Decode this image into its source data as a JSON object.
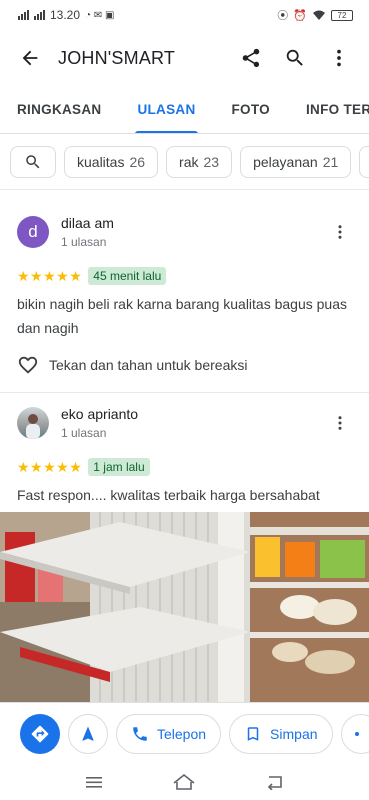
{
  "status_bar": {
    "time": "13.20",
    "battery": "72"
  },
  "app_bar": {
    "title": "JOHN'SMART"
  },
  "tabs": [
    {
      "label": "RINGKASAN"
    },
    {
      "label": "ULASAN"
    },
    {
      "label": "FOTO"
    },
    {
      "label": "INFO TERBARU"
    }
  ],
  "filter_chips": [
    {
      "label": "kualitas",
      "count": "26"
    },
    {
      "label": "rak",
      "count": "23"
    },
    {
      "label": "pelayanan",
      "count": "21"
    }
  ],
  "reviews": [
    {
      "avatar_letter": "d",
      "name": "dilaa am",
      "meta": "1 ulasan",
      "stars": "★★★★★",
      "time": "45 menit lalu",
      "text": "bikin nagih beli rak karna barang kualitas bagus puas dan nagih",
      "react_label": "Tekan dan tahan untuk bereaksi"
    },
    {
      "name": "eko aprianto",
      "meta": "1 ulasan",
      "stars": "★★★★★",
      "time": "1 jam lalu",
      "text": "Fast respon.... kwalitas terbaik harga bersahabat"
    }
  ],
  "bottom_actions": {
    "call_label": "Telepon",
    "save_label": "Simpan"
  },
  "colors": {
    "accent": "#1a73e8",
    "star": "#fbbc04",
    "badge_bg": "#ceead6",
    "badge_text": "#0d652d"
  }
}
